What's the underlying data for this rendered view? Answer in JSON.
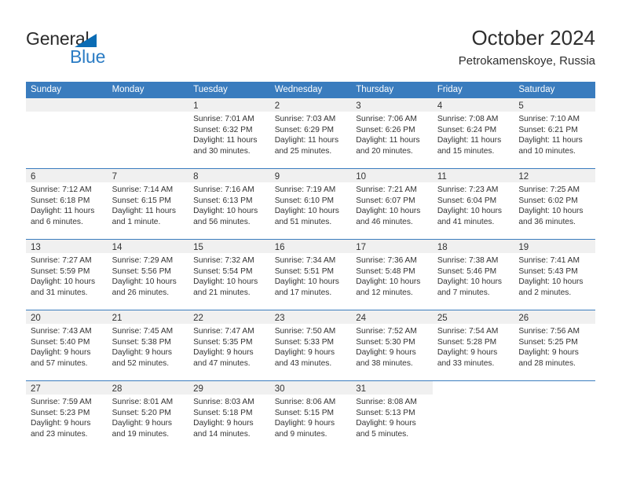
{
  "brand": {
    "name_part1": "General",
    "name_part2": "Blue",
    "accent_color": "#2b7cc4",
    "triangle_color": "#0a6cb5"
  },
  "header": {
    "title": "October 2024",
    "subtitle": "Petrokamenskoye, Russia"
  },
  "calendar": {
    "header_bg": "#3a7cbe",
    "day_band_bg": "#f0f0f0",
    "day_names": [
      "Sunday",
      "Monday",
      "Tuesday",
      "Wednesday",
      "Thursday",
      "Friday",
      "Saturday"
    ],
    "weeks": [
      [
        {
          "empty": true
        },
        {
          "empty": true
        },
        {
          "day": "1",
          "sunrise": "Sunrise: 7:01 AM",
          "sunset": "Sunset: 6:32 PM",
          "daylight_line1": "Daylight: 11 hours",
          "daylight_line2": "and 30 minutes."
        },
        {
          "day": "2",
          "sunrise": "Sunrise: 7:03 AM",
          "sunset": "Sunset: 6:29 PM",
          "daylight_line1": "Daylight: 11 hours",
          "daylight_line2": "and 25 minutes."
        },
        {
          "day": "3",
          "sunrise": "Sunrise: 7:06 AM",
          "sunset": "Sunset: 6:26 PM",
          "daylight_line1": "Daylight: 11 hours",
          "daylight_line2": "and 20 minutes."
        },
        {
          "day": "4",
          "sunrise": "Sunrise: 7:08 AM",
          "sunset": "Sunset: 6:24 PM",
          "daylight_line1": "Daylight: 11 hours",
          "daylight_line2": "and 15 minutes."
        },
        {
          "day": "5",
          "sunrise": "Sunrise: 7:10 AM",
          "sunset": "Sunset: 6:21 PM",
          "daylight_line1": "Daylight: 11 hours",
          "daylight_line2": "and 10 minutes."
        }
      ],
      [
        {
          "day": "6",
          "sunrise": "Sunrise: 7:12 AM",
          "sunset": "Sunset: 6:18 PM",
          "daylight_line1": "Daylight: 11 hours",
          "daylight_line2": "and 6 minutes."
        },
        {
          "day": "7",
          "sunrise": "Sunrise: 7:14 AM",
          "sunset": "Sunset: 6:15 PM",
          "daylight_line1": "Daylight: 11 hours",
          "daylight_line2": "and 1 minute."
        },
        {
          "day": "8",
          "sunrise": "Sunrise: 7:16 AM",
          "sunset": "Sunset: 6:13 PM",
          "daylight_line1": "Daylight: 10 hours",
          "daylight_line2": "and 56 minutes."
        },
        {
          "day": "9",
          "sunrise": "Sunrise: 7:19 AM",
          "sunset": "Sunset: 6:10 PM",
          "daylight_line1": "Daylight: 10 hours",
          "daylight_line2": "and 51 minutes."
        },
        {
          "day": "10",
          "sunrise": "Sunrise: 7:21 AM",
          "sunset": "Sunset: 6:07 PM",
          "daylight_line1": "Daylight: 10 hours",
          "daylight_line2": "and 46 minutes."
        },
        {
          "day": "11",
          "sunrise": "Sunrise: 7:23 AM",
          "sunset": "Sunset: 6:04 PM",
          "daylight_line1": "Daylight: 10 hours",
          "daylight_line2": "and 41 minutes."
        },
        {
          "day": "12",
          "sunrise": "Sunrise: 7:25 AM",
          "sunset": "Sunset: 6:02 PM",
          "daylight_line1": "Daylight: 10 hours",
          "daylight_line2": "and 36 minutes."
        }
      ],
      [
        {
          "day": "13",
          "sunrise": "Sunrise: 7:27 AM",
          "sunset": "Sunset: 5:59 PM",
          "daylight_line1": "Daylight: 10 hours",
          "daylight_line2": "and 31 minutes."
        },
        {
          "day": "14",
          "sunrise": "Sunrise: 7:29 AM",
          "sunset": "Sunset: 5:56 PM",
          "daylight_line1": "Daylight: 10 hours",
          "daylight_line2": "and 26 minutes."
        },
        {
          "day": "15",
          "sunrise": "Sunrise: 7:32 AM",
          "sunset": "Sunset: 5:54 PM",
          "daylight_line1": "Daylight: 10 hours",
          "daylight_line2": "and 21 minutes."
        },
        {
          "day": "16",
          "sunrise": "Sunrise: 7:34 AM",
          "sunset": "Sunset: 5:51 PM",
          "daylight_line1": "Daylight: 10 hours",
          "daylight_line2": "and 17 minutes."
        },
        {
          "day": "17",
          "sunrise": "Sunrise: 7:36 AM",
          "sunset": "Sunset: 5:48 PM",
          "daylight_line1": "Daylight: 10 hours",
          "daylight_line2": "and 12 minutes."
        },
        {
          "day": "18",
          "sunrise": "Sunrise: 7:38 AM",
          "sunset": "Sunset: 5:46 PM",
          "daylight_line1": "Daylight: 10 hours",
          "daylight_line2": "and 7 minutes."
        },
        {
          "day": "19",
          "sunrise": "Sunrise: 7:41 AM",
          "sunset": "Sunset: 5:43 PM",
          "daylight_line1": "Daylight: 10 hours",
          "daylight_line2": "and 2 minutes."
        }
      ],
      [
        {
          "day": "20",
          "sunrise": "Sunrise: 7:43 AM",
          "sunset": "Sunset: 5:40 PM",
          "daylight_line1": "Daylight: 9 hours",
          "daylight_line2": "and 57 minutes."
        },
        {
          "day": "21",
          "sunrise": "Sunrise: 7:45 AM",
          "sunset": "Sunset: 5:38 PM",
          "daylight_line1": "Daylight: 9 hours",
          "daylight_line2": "and 52 minutes."
        },
        {
          "day": "22",
          "sunrise": "Sunrise: 7:47 AM",
          "sunset": "Sunset: 5:35 PM",
          "daylight_line1": "Daylight: 9 hours",
          "daylight_line2": "and 47 minutes."
        },
        {
          "day": "23",
          "sunrise": "Sunrise: 7:50 AM",
          "sunset": "Sunset: 5:33 PM",
          "daylight_line1": "Daylight: 9 hours",
          "daylight_line2": "and 43 minutes."
        },
        {
          "day": "24",
          "sunrise": "Sunrise: 7:52 AM",
          "sunset": "Sunset: 5:30 PM",
          "daylight_line1": "Daylight: 9 hours",
          "daylight_line2": "and 38 minutes."
        },
        {
          "day": "25",
          "sunrise": "Sunrise: 7:54 AM",
          "sunset": "Sunset: 5:28 PM",
          "daylight_line1": "Daylight: 9 hours",
          "daylight_line2": "and 33 minutes."
        },
        {
          "day": "26",
          "sunrise": "Sunrise: 7:56 AM",
          "sunset": "Sunset: 5:25 PM",
          "daylight_line1": "Daylight: 9 hours",
          "daylight_line2": "and 28 minutes."
        }
      ],
      [
        {
          "day": "27",
          "sunrise": "Sunrise: 7:59 AM",
          "sunset": "Sunset: 5:23 PM",
          "daylight_line1": "Daylight: 9 hours",
          "daylight_line2": "and 23 minutes."
        },
        {
          "day": "28",
          "sunrise": "Sunrise: 8:01 AM",
          "sunset": "Sunset: 5:20 PM",
          "daylight_line1": "Daylight: 9 hours",
          "daylight_line2": "and 19 minutes."
        },
        {
          "day": "29",
          "sunrise": "Sunrise: 8:03 AM",
          "sunset": "Sunset: 5:18 PM",
          "daylight_line1": "Daylight: 9 hours",
          "daylight_line2": "and 14 minutes."
        },
        {
          "day": "30",
          "sunrise": "Sunrise: 8:06 AM",
          "sunset": "Sunset: 5:15 PM",
          "daylight_line1": "Daylight: 9 hours",
          "daylight_line2": "and 9 minutes."
        },
        {
          "day": "31",
          "sunrise": "Sunrise: 8:08 AM",
          "sunset": "Sunset: 5:13 PM",
          "daylight_line1": "Daylight: 9 hours",
          "daylight_line2": "and 5 minutes."
        },
        {
          "blank": true
        },
        {
          "blank": true
        }
      ]
    ]
  }
}
